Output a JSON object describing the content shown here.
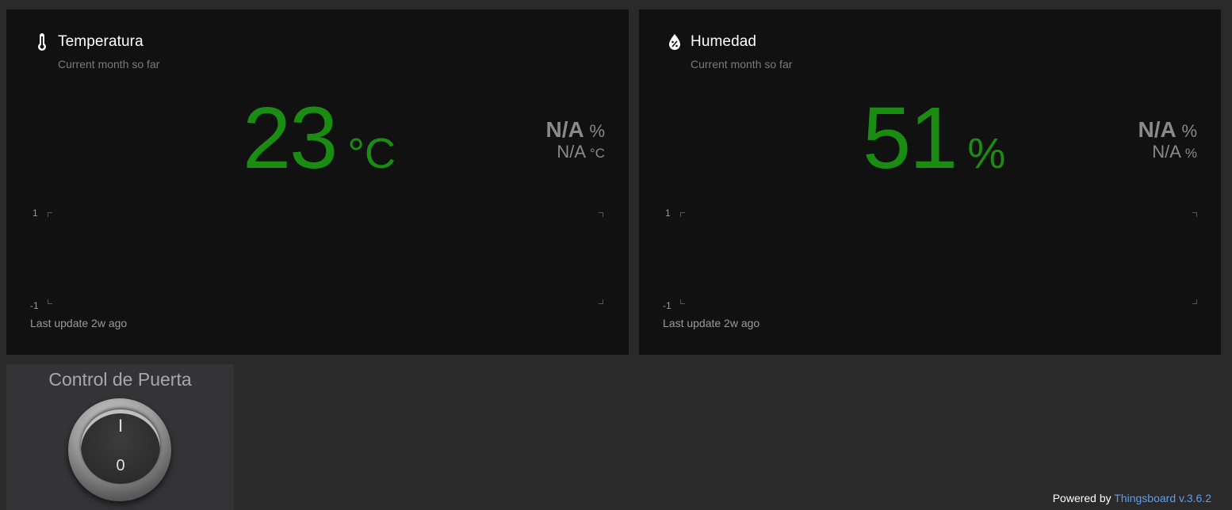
{
  "temperature": {
    "title": "Temperatura",
    "subtitle": "Current month so far",
    "value": "23",
    "unit": "°C",
    "stat1_value": "N/A",
    "stat1_unit": "%",
    "stat2_value": "N/A",
    "stat2_unit": "°C",
    "axis_top": "1",
    "axis_bottom": "-1",
    "last_update": "Last update 2w ago",
    "icon": "thermometer-icon",
    "value_color": "#1a8c12"
  },
  "humidity": {
    "title": "Humedad",
    "subtitle": "Current month so far",
    "value": "51",
    "unit": "%",
    "stat1_value": "N/A",
    "stat1_unit": "%",
    "stat2_value": "N/A",
    "stat2_unit": "%",
    "axis_top": "1",
    "axis_bottom": "-1",
    "last_update": "Last update 2w ago",
    "icon": "water-drop-percent-icon",
    "value_color": "#1a8c12"
  },
  "door_control": {
    "title": "Control de Puerta",
    "on_label": "I",
    "off_label": "0"
  },
  "footer": {
    "powered_by": "Powered by",
    "link_text": "Thingsboard v.3.6.2",
    "link_color": "#5a9fef"
  }
}
